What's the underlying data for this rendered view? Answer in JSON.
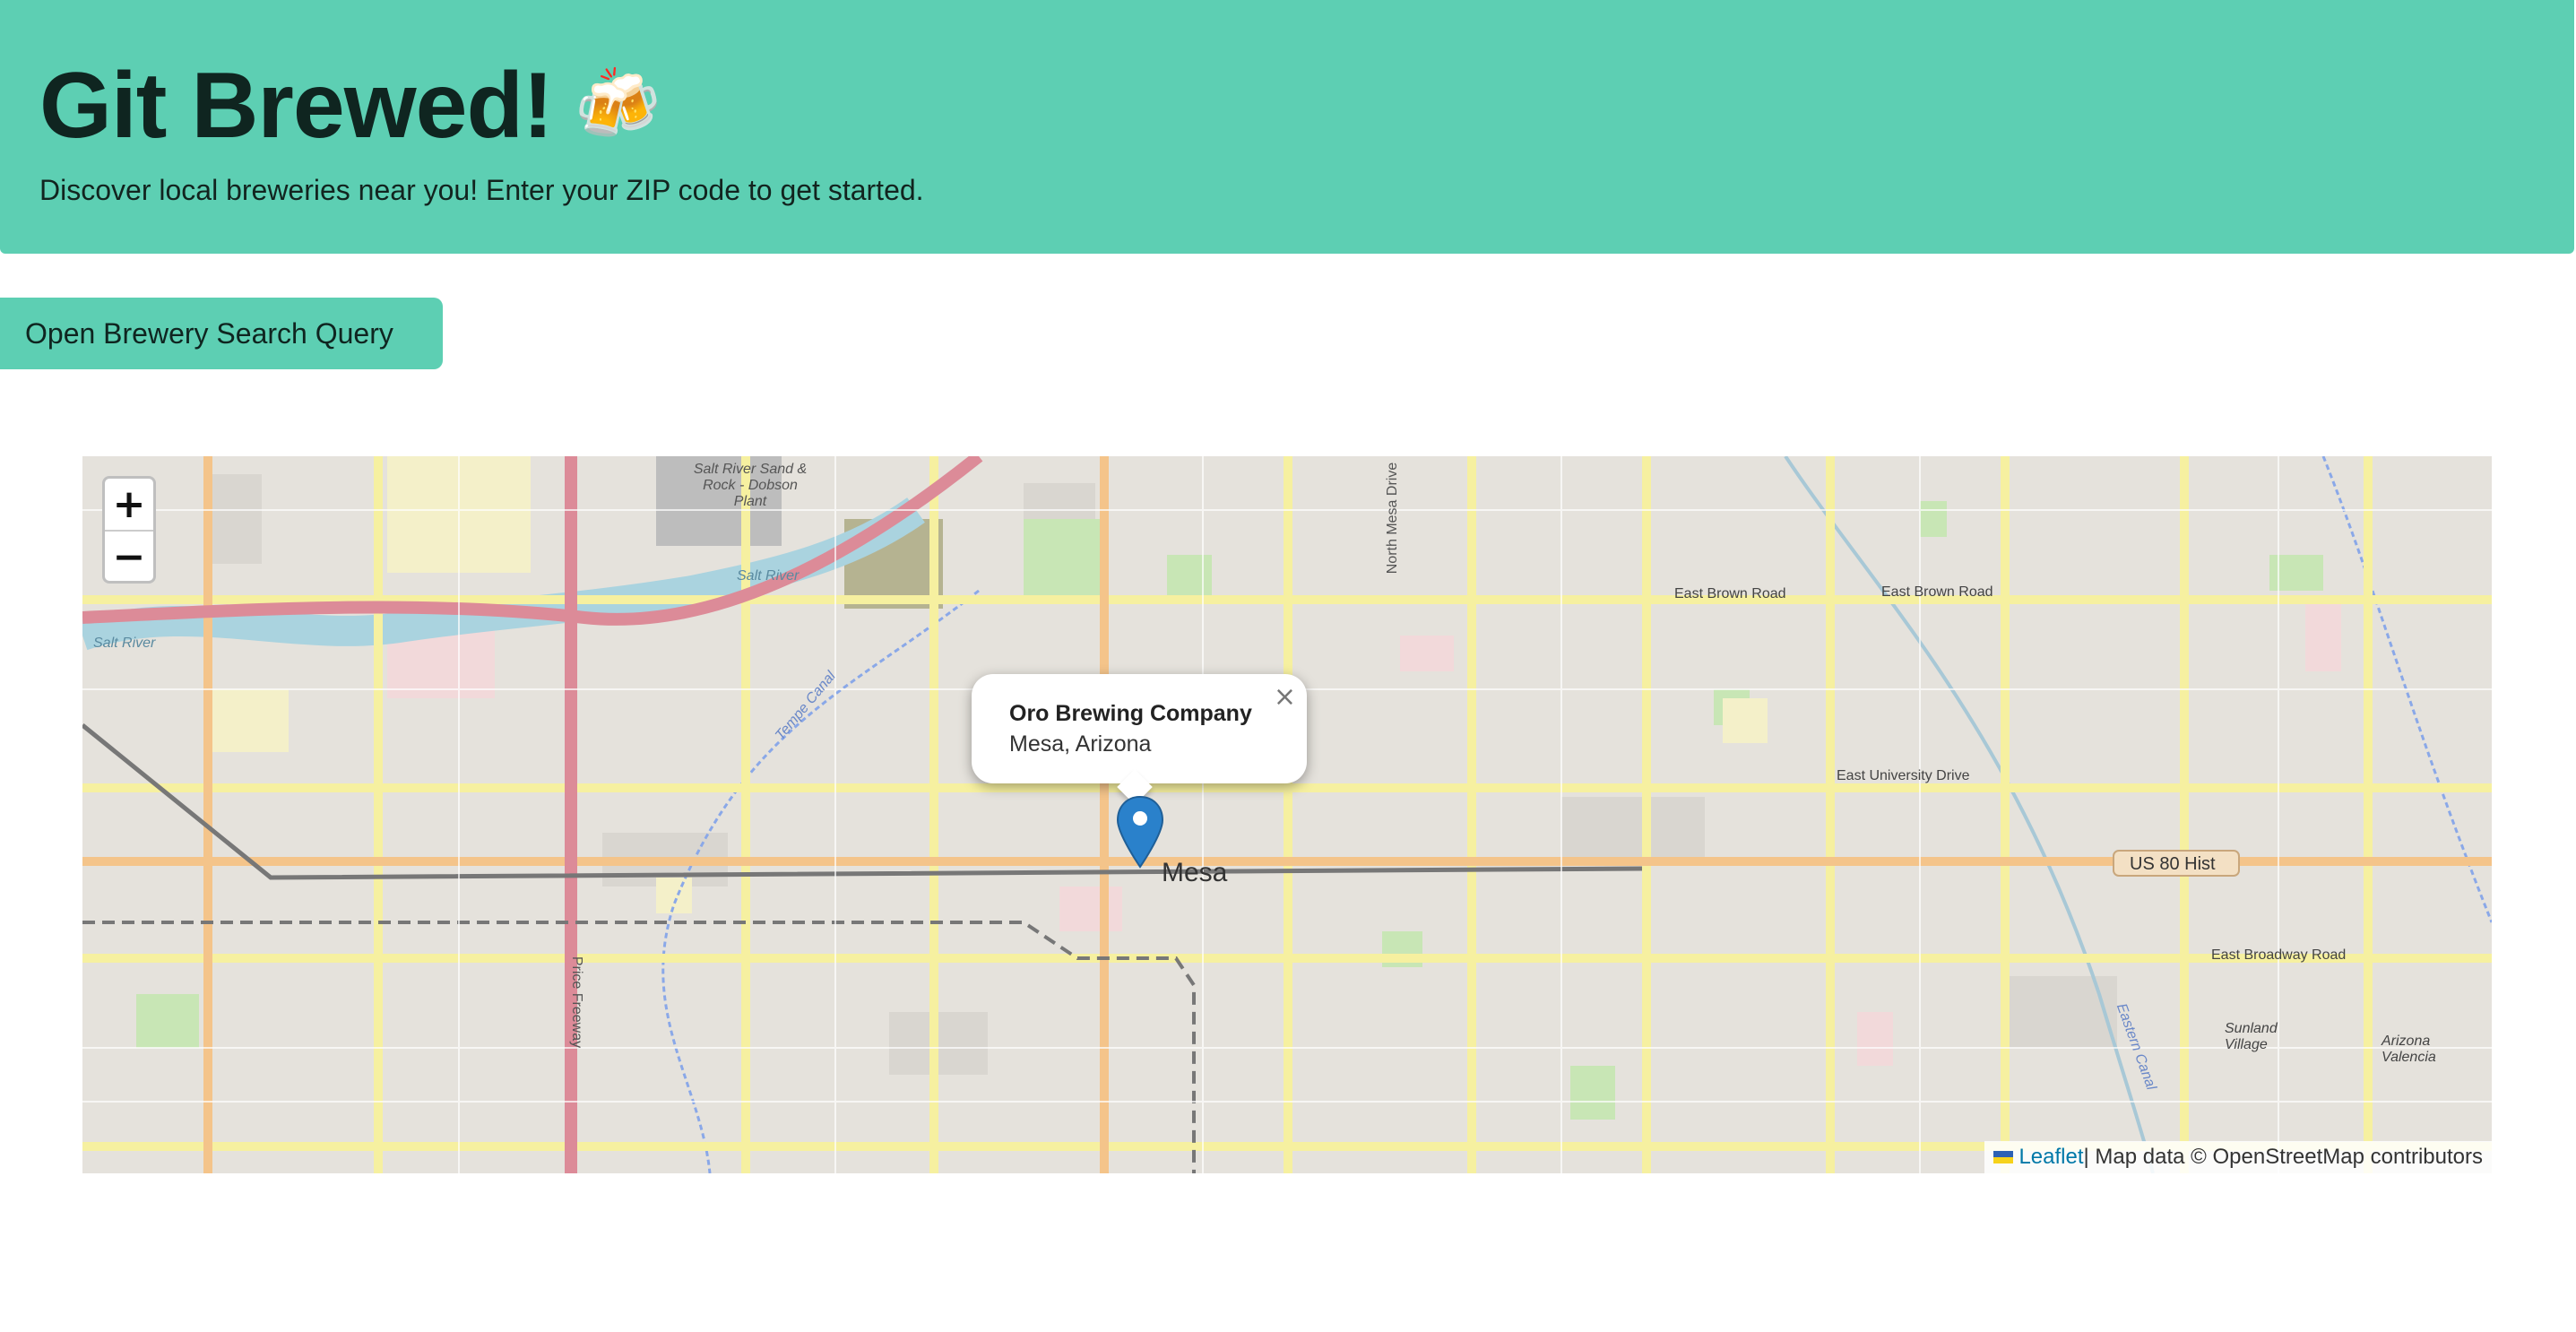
{
  "header": {
    "title": "Git Brewed!",
    "title_emoji": "🍻",
    "subtitle": "Discover local breweries near you! Enter your ZIP code to get started."
  },
  "open_button_label": "Open Brewery Search Query",
  "map": {
    "zoom_in": "+",
    "zoom_out": "−",
    "popup": {
      "name": "Oro Brewing Company",
      "location": "Mesa, Arizona",
      "close": "×"
    },
    "labels": {
      "city": "Mesa",
      "us80": "US 80 Hist",
      "east_brown_1": "East Brown Road",
      "east_brown_2": "East Brown Road",
      "east_university": "East University Drive",
      "east_broadway": "East Broadway Road",
      "sunland": "Sunland Village",
      "arizona_valencia": "Arizona Valencia",
      "salt_river": "Salt River",
      "salt_river_2": "Salt River",
      "plant": "Salt River Sand & Rock - Dobson Plant",
      "tempe_canal": "Tempe Canal",
      "eastern_canal": "Eastern Canal",
      "price_freeway": "Price Freeway",
      "north_mesa": "North Mesa Drive"
    },
    "attribution": {
      "leaflet": "Leaflet",
      "rest": " | Map data © OpenStreetMap contributors"
    }
  },
  "colors": {
    "accent": "#5dcfb3",
    "marker": "#2a81cb",
    "link": "#0078a8"
  }
}
